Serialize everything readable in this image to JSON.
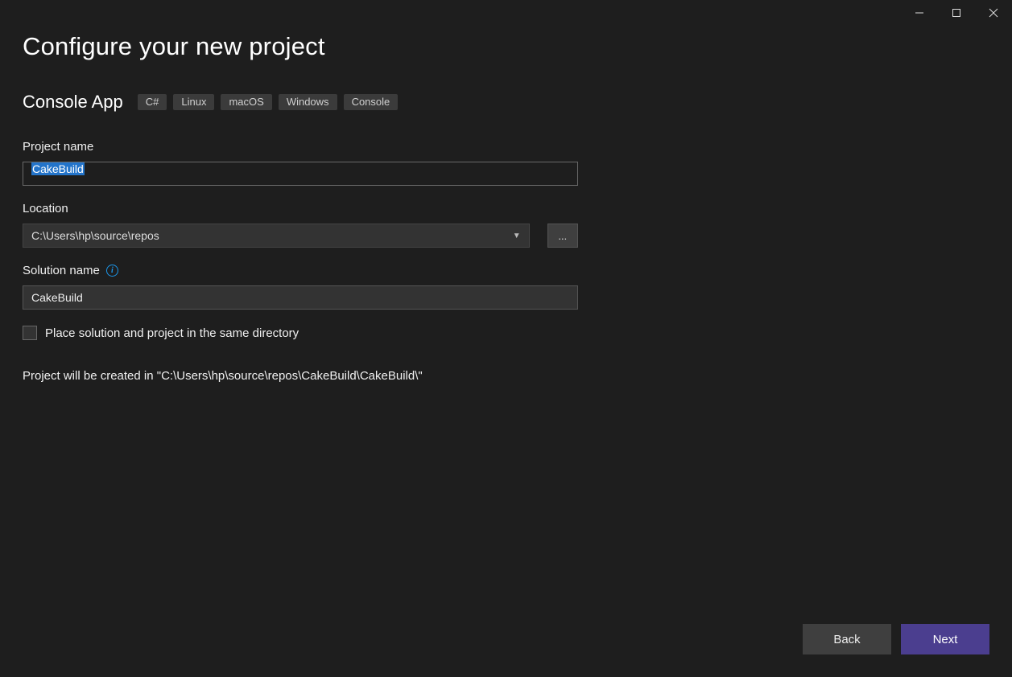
{
  "header": {
    "title": "Configure your new project"
  },
  "template": {
    "name": "Console App",
    "tags": [
      "C#",
      "Linux",
      "macOS",
      "Windows",
      "Console"
    ]
  },
  "fields": {
    "project_name": {
      "label": "Project name",
      "value": "CakeBuild"
    },
    "location": {
      "label": "Location",
      "value": "C:\\Users\\hp\\source\\repos",
      "browse_label": "..."
    },
    "solution_name": {
      "label": "Solution name",
      "value": "CakeBuild"
    },
    "same_directory": {
      "checked": false,
      "label": "Place solution and project in the same directory"
    }
  },
  "summary": "Project will be created in \"C:\\Users\\hp\\source\\repos\\CakeBuild\\CakeBuild\\\"",
  "buttons": {
    "back": "Back",
    "next": "Next"
  },
  "icons": {
    "info": "info-icon",
    "minimize": "minimize-icon",
    "maximize": "maximize-icon",
    "close": "close-icon",
    "chevron_down": "chevron-down-icon"
  }
}
